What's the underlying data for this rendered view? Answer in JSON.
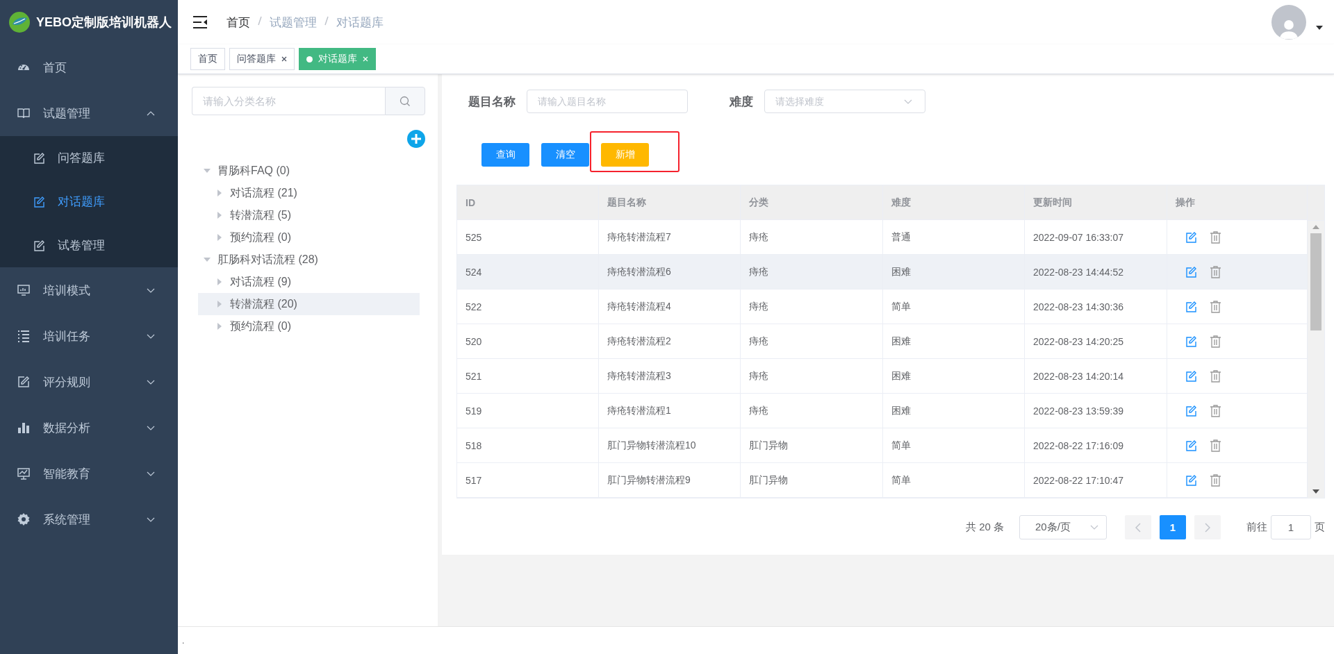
{
  "app": {
    "title": "YEBO定制版培训机器人"
  },
  "sidebar": {
    "items": [
      {
        "label": "首页",
        "kind": "link"
      },
      {
        "label": "试题管理",
        "kind": "group",
        "expanded": true,
        "children": [
          {
            "label": "问答题库",
            "selected": false
          },
          {
            "label": "对话题库",
            "selected": true
          },
          {
            "label": "试卷管理",
            "selected": false
          }
        ]
      },
      {
        "label": "培训模式",
        "kind": "group",
        "expanded": false
      },
      {
        "label": "培训任务",
        "kind": "group",
        "expanded": false
      },
      {
        "label": "评分规则",
        "kind": "group",
        "expanded": false
      },
      {
        "label": "数据分析",
        "kind": "group",
        "expanded": false
      },
      {
        "label": "智能教育",
        "kind": "group",
        "expanded": false
      },
      {
        "label": "系统管理",
        "kind": "group",
        "expanded": false
      }
    ]
  },
  "breadcrumb": [
    {
      "label": "首页",
      "link": false
    },
    {
      "label": "试题管理",
      "link": true
    },
    {
      "label": "对话题库",
      "link": true
    }
  ],
  "tags": [
    {
      "label": "首页",
      "closable": false,
      "selected": false
    },
    {
      "label": "问答题库",
      "closable": true,
      "selected": false
    },
    {
      "label": "对话题库",
      "closable": true,
      "selected": true
    }
  ],
  "tree": {
    "search": {
      "placeholder": "请输入分类名称"
    },
    "nodes": [
      {
        "label": "胃肠科FAQ (0)",
        "expanded": true,
        "selected": false,
        "children": [
          {
            "label": "对话流程 (21)",
            "expanded": false,
            "selected": false
          },
          {
            "label": "转潜流程 (5)",
            "expanded": false,
            "selected": false
          },
          {
            "label": "预约流程 (0)",
            "expanded": false,
            "selected": false
          }
        ]
      },
      {
        "label": "肛肠科对话流程 (28)",
        "expanded": true,
        "selected": false,
        "children": [
          {
            "label": "对话流程 (9)",
            "expanded": false,
            "selected": false
          },
          {
            "label": "转潜流程 (20)",
            "expanded": false,
            "selected": true
          },
          {
            "label": "预约流程 (0)",
            "expanded": false,
            "selected": false
          }
        ]
      }
    ]
  },
  "filters": [
    {
      "label": "题目名称",
      "kind": "input",
      "placeholder": "请输入题目名称"
    },
    {
      "label": "难度",
      "kind": "select",
      "placeholder": "请选择难度"
    }
  ],
  "buttons": [
    {
      "label": "查询",
      "kind": "primary",
      "highlighted": false
    },
    {
      "label": "清空",
      "kind": "primary",
      "highlighted": false
    },
    {
      "label": "新增",
      "kind": "warning",
      "highlighted": true
    }
  ],
  "table": {
    "columns": [
      "ID",
      "题目名称",
      "分类",
      "难度",
      "更新时间",
      "操作"
    ],
    "rows": [
      {
        "cells": [
          "525",
          "痔疮转潜流程7",
          "痔疮",
          "普通",
          "2022-09-07 16:33:07"
        ],
        "selected": false
      },
      {
        "cells": [
          "524",
          "痔疮转潜流程6",
          "痔疮",
          "困难",
          "2022-08-23 14:44:52"
        ],
        "selected": true
      },
      {
        "cells": [
          "522",
          "痔疮转潜流程4",
          "痔疮",
          "简单",
          "2022-08-23 14:30:36"
        ],
        "selected": false
      },
      {
        "cells": [
          "520",
          "痔疮转潜流程2",
          "痔疮",
          "困难",
          "2022-08-23 14:20:25"
        ],
        "selected": false
      },
      {
        "cells": [
          "521",
          "痔疮转潜流程3",
          "痔疮",
          "困难",
          "2022-08-23 14:20:14"
        ],
        "selected": false
      },
      {
        "cells": [
          "519",
          "痔疮转潜流程1",
          "痔疮",
          "困难",
          "2022-08-23 13:59:39"
        ],
        "selected": false
      },
      {
        "cells": [
          "518",
          "肛门异物转潜流程10",
          "肛门异物",
          "简单",
          "2022-08-22 17:16:09"
        ],
        "selected": false
      },
      {
        "cells": [
          "517",
          "肛门异物转潜流程9",
          "肛门异物",
          "简单",
          "2022-08-22 17:10:47"
        ],
        "selected": false
      }
    ]
  },
  "pagination": {
    "total": "共 20 条",
    "page_size": "20条/页",
    "pages": [
      {
        "label": "1",
        "selected": true
      }
    ],
    "jump_label": "前往",
    "jump_value": "1",
    "jump_suffix": "页"
  },
  "footer": {
    "text": "."
  }
}
